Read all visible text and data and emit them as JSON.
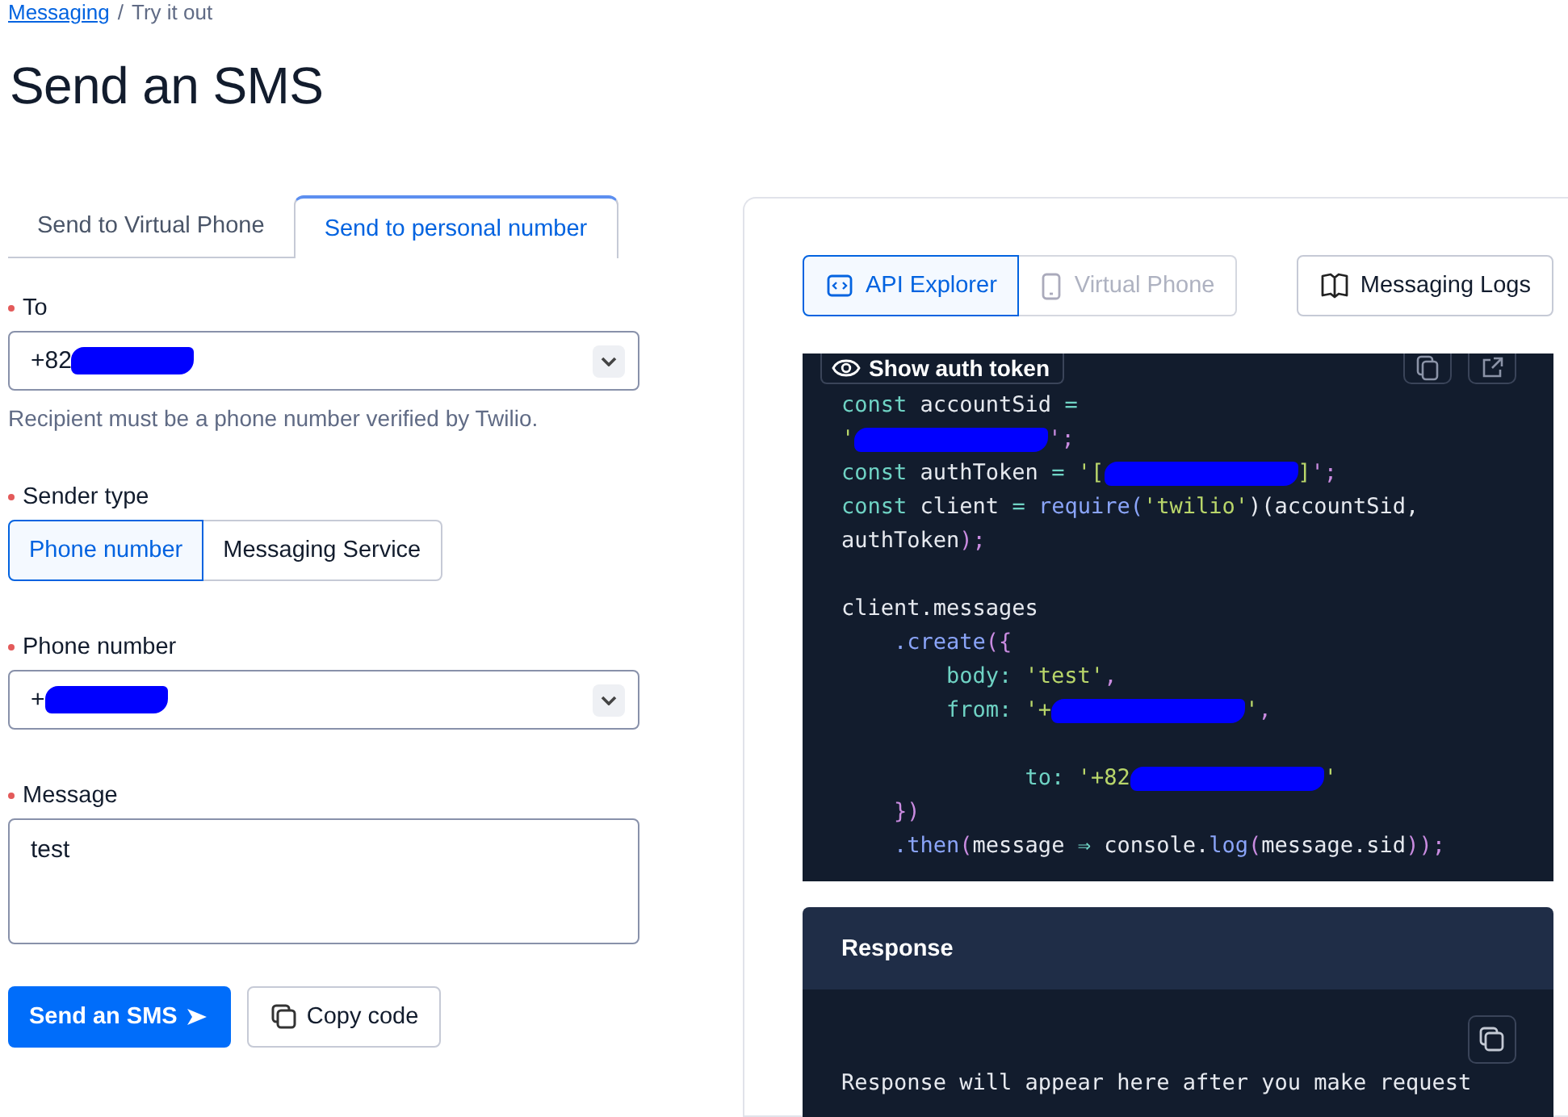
{
  "breadcrumb": [
    {
      "label": "Messaging",
      "kind": "link"
    },
    {
      "label": "Try it out",
      "kind": "current"
    }
  ],
  "breadcrumb_separator": "/",
  "title": "Send an SMS",
  "tabs": [
    {
      "label": "Send to Virtual Phone",
      "selected": false
    },
    {
      "label": "Send to personal number",
      "selected": true
    }
  ],
  "form": {
    "to": {
      "label": "To",
      "required": true,
      "value": "+82",
      "redacted": true,
      "help": "Recipient must be a phone number verified by Twilio."
    },
    "sender_type": {
      "label": "Sender type",
      "required": true,
      "options": [
        {
          "label": "Phone number",
          "selected": true
        },
        {
          "label": "Messaging Service",
          "selected": false
        }
      ]
    },
    "phone_number": {
      "label": "Phone number",
      "required": true,
      "value": "+",
      "redacted": true
    },
    "message": {
      "label": "Message",
      "required": true,
      "value": "test"
    },
    "buttons": [
      {
        "label": "Send an SMS",
        "kind": "primary"
      },
      {
        "label": "Copy code",
        "kind": "copy"
      }
    ]
  },
  "panel": {
    "views": [
      {
        "label": "API Explorer",
        "selected": true,
        "disabled": false,
        "kind": "code"
      },
      {
        "label": "Virtual Phone",
        "selected": false,
        "disabled": true,
        "kind": "phone"
      }
    ],
    "logs_button": "Messaging Logs",
    "show_token": "Show auth token",
    "code": [
      {
        "kind": "code",
        "tokens": [
          {
            "kind": "kw",
            "text": "const "
          },
          {
            "kind": "id",
            "text": "accountSid "
          },
          {
            "kind": "op",
            "text": "="
          }
        ]
      },
      {
        "kind": "code",
        "tokens": [
          {
            "kind": "str",
            "text": "'"
          },
          {
            "kind": "redacted"
          },
          {
            "kind": "punct",
            "text": "';"
          }
        ]
      },
      {
        "kind": "code",
        "tokens": [
          {
            "kind": "kw",
            "text": "const "
          },
          {
            "kind": "id",
            "text": "authToken "
          },
          {
            "kind": "op",
            "text": "= "
          },
          {
            "kind": "str",
            "text": "'["
          },
          {
            "kind": "redacted"
          },
          {
            "kind": "str",
            "text": "]"
          },
          {
            "kind": "punct",
            "text": "';"
          }
        ]
      },
      {
        "kind": "code",
        "tokens": [
          {
            "kind": "kw",
            "text": "const "
          },
          {
            "kind": "id",
            "text": "client "
          },
          {
            "kind": "op",
            "text": "= "
          },
          {
            "kind": "fn",
            "text": "require("
          },
          {
            "kind": "str",
            "text": "'twilio'"
          },
          {
            "kind": "id",
            "text": ")(accountSid,"
          }
        ]
      },
      {
        "kind": "code",
        "tokens": [
          {
            "kind": "id",
            "text": "authToken"
          },
          {
            "kind": "punct",
            "text": ");"
          }
        ]
      },
      {
        "kind": "blank"
      },
      {
        "kind": "code",
        "tokens": [
          {
            "kind": "id",
            "text": "client.messages"
          }
        ]
      },
      {
        "kind": "code",
        "tokens": [
          {
            "kind": "fn",
            "text": "    .create"
          },
          {
            "kind": "punct",
            "text": "({"
          }
        ]
      },
      {
        "kind": "code",
        "tokens": [
          {
            "kind": "kw",
            "text": "        body: "
          },
          {
            "kind": "str",
            "text": "'test'"
          },
          {
            "kind": "punct",
            "text": ","
          }
        ]
      },
      {
        "kind": "code",
        "tokens": [
          {
            "kind": "kw",
            "text": "        from: "
          },
          {
            "kind": "str",
            "text": "'+"
          },
          {
            "kind": "redacted"
          },
          {
            "kind": "str",
            "text": "'"
          },
          {
            "kind": "punct",
            "text": ","
          }
        ]
      },
      {
        "kind": "blank"
      },
      {
        "kind": "code",
        "tokens": [
          {
            "kind": "kw",
            "text": "              to: "
          },
          {
            "kind": "str",
            "text": "'+82"
          },
          {
            "kind": "redacted"
          },
          {
            "kind": "str",
            "text": "'"
          }
        ]
      },
      {
        "kind": "code",
        "tokens": [
          {
            "kind": "punct",
            "text": "    })"
          }
        ]
      },
      {
        "kind": "code",
        "tokens": [
          {
            "kind": "fn",
            "text": "    .then"
          },
          {
            "kind": "punct",
            "text": "("
          },
          {
            "kind": "id",
            "text": "message "
          },
          {
            "kind": "op",
            "text": "⇒ "
          },
          {
            "kind": "id",
            "text": "console."
          },
          {
            "kind": "fn",
            "text": "log"
          },
          {
            "kind": "punct",
            "text": "("
          },
          {
            "kind": "id",
            "text": "message.sid"
          },
          {
            "kind": "punct",
            "text": "));"
          }
        ]
      }
    ],
    "response_title": "Response",
    "response_text": "Response will appear here after you make request"
  }
}
